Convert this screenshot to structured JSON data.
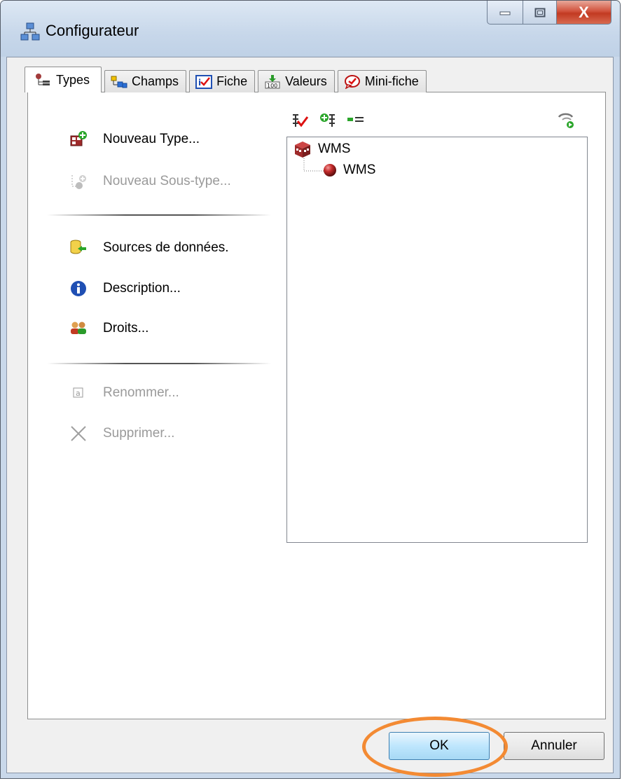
{
  "window": {
    "title": "Configurateur",
    "close_glyph": "X"
  },
  "tabs": [
    {
      "label": "Types",
      "icon": "types-icon",
      "active": true
    },
    {
      "label": "Champs",
      "icon": "fields-icon",
      "active": false
    },
    {
      "label": "Fiche",
      "icon": "form-icon",
      "active": false
    },
    {
      "label": "Valeurs",
      "icon": "values-icon",
      "active": false
    },
    {
      "label": "Mini-fiche",
      "icon": "minifiche-icon",
      "active": false
    }
  ],
  "actions": {
    "new_type": "Nouveau Type...",
    "new_subtype": "Nouveau Sous-type...",
    "data_sources": "Sources de données.",
    "description": "Description...",
    "rights": "Droits...",
    "rename": "Renommer...",
    "delete": "Supprimer..."
  },
  "tree": {
    "root": "WMS",
    "child": "WMS"
  },
  "buttons": {
    "ok": "OK",
    "cancel": "Annuler"
  },
  "colors": {
    "highlight": "#f38a33",
    "close_button": "#c23a22",
    "ok_button": "#bee6fd"
  }
}
